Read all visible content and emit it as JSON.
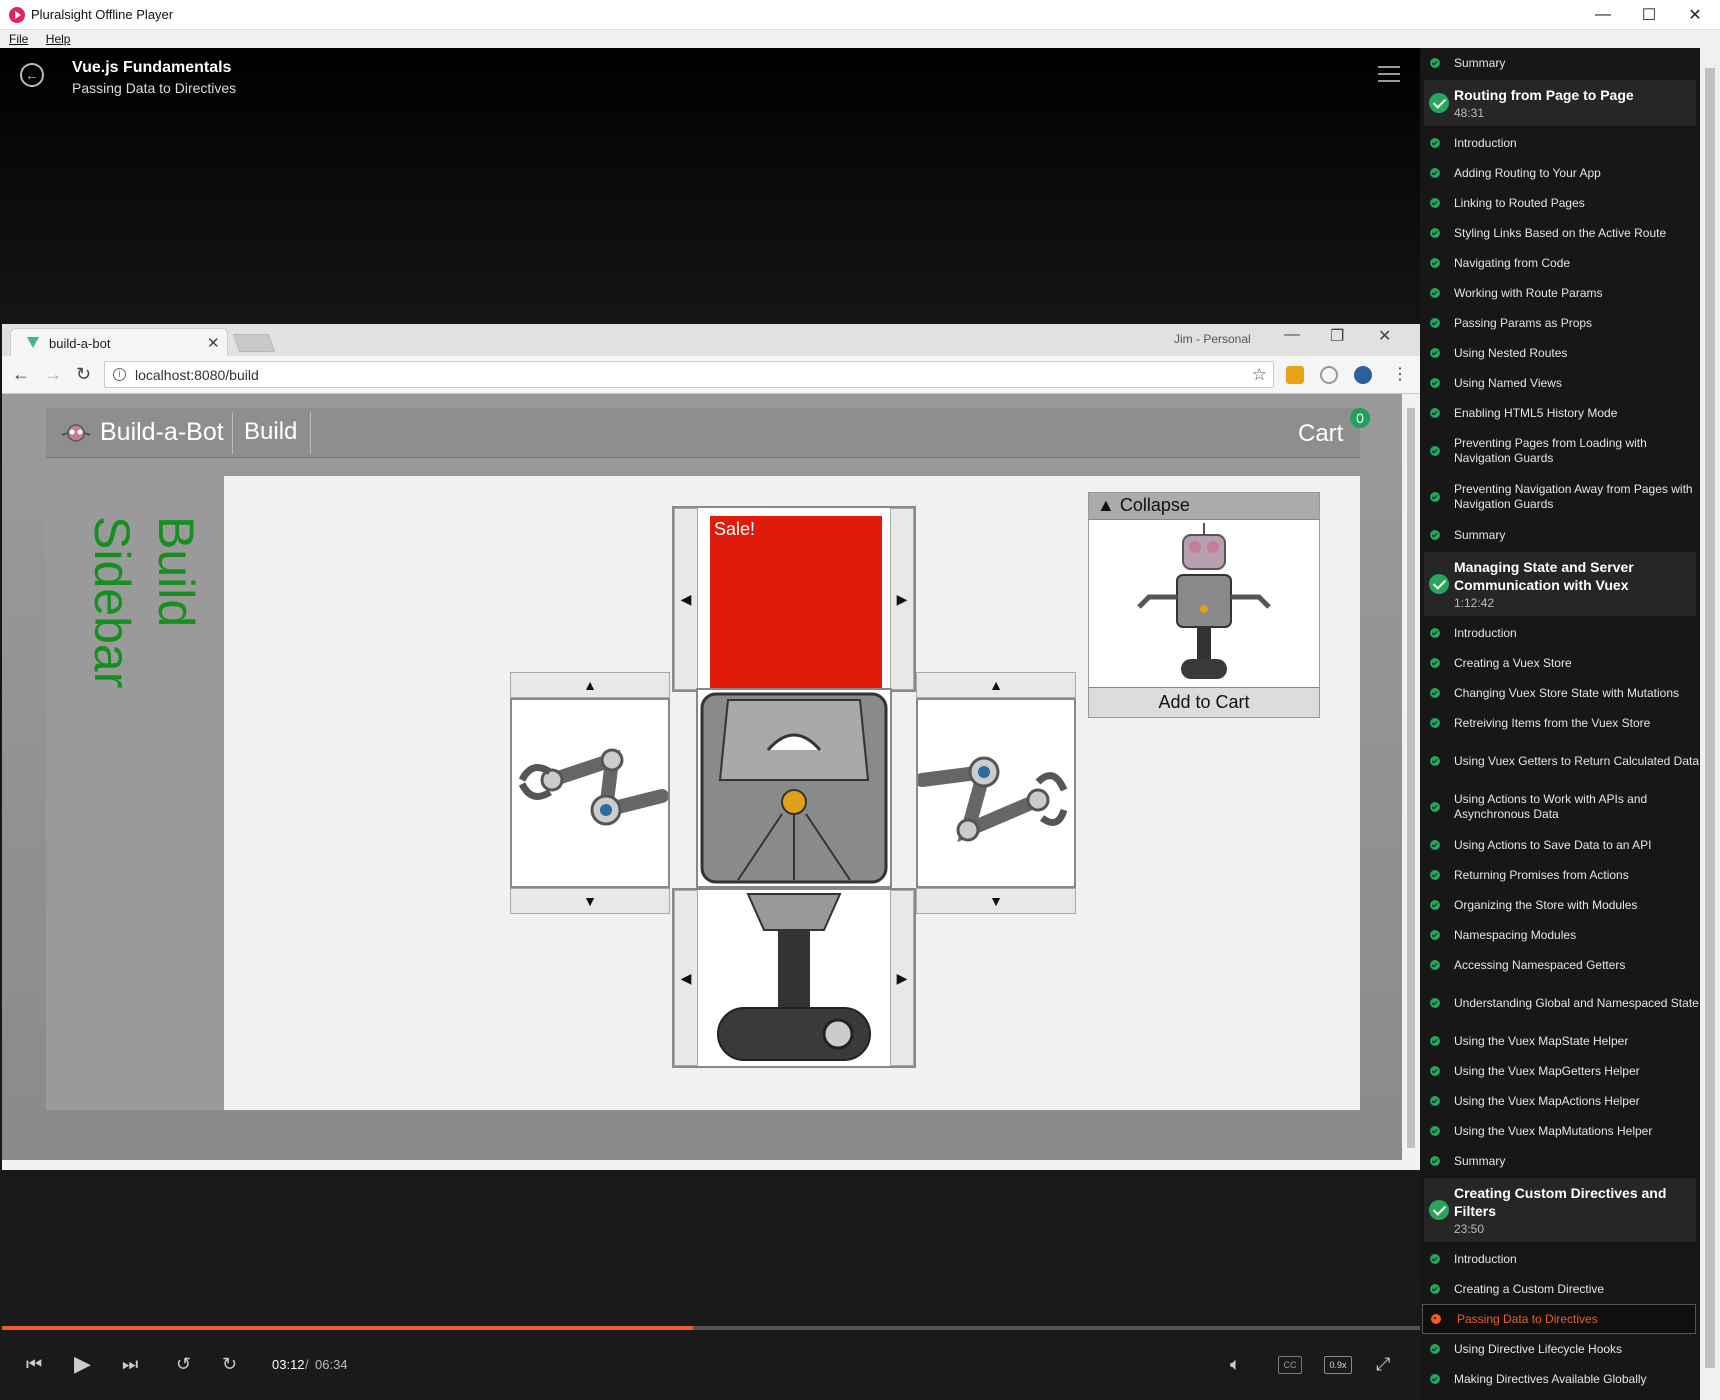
{
  "window": {
    "title": "Pluralsight Offline Player",
    "minimize": "—",
    "maximize": "☐",
    "close": "✕"
  },
  "menu": {
    "file": "File",
    "help": "Help"
  },
  "header": {
    "course_title": "Vue.js Fundamentals",
    "clip_title": "Passing Data to Directives"
  },
  "browser": {
    "tab_title": "build-a-bot",
    "profile": "Jim - Personal",
    "url": "localhost:8080/build"
  },
  "app": {
    "brand": "Build-a-Bot",
    "nav_build": "Build",
    "cart_label": "Cart",
    "cart_count": "0",
    "sidebar_text": "Build\nSidebar",
    "sale_label": "Sale!",
    "collapse_label": "▲ Collapse",
    "add_to_cart": "Add to Cart",
    "arrow_left": "◀",
    "arrow_right": "▶",
    "arrow_up": "▲",
    "arrow_down": "▼"
  },
  "player": {
    "current_time": "03:12",
    "separator": "/",
    "total_time": "06:34",
    "progress_fraction": 0.487,
    "speed": "0.9x",
    "cc": "CC"
  },
  "toc": {
    "items": [
      {
        "kind": "clip",
        "label": "Summary"
      },
      {
        "kind": "module",
        "label": "Routing from Page to Page",
        "duration": "48:31"
      },
      {
        "kind": "clip",
        "label": "Introduction"
      },
      {
        "kind": "clip",
        "label": "Adding Routing to Your App"
      },
      {
        "kind": "clip",
        "label": "Linking to Routed Pages"
      },
      {
        "kind": "clip",
        "label": "Styling Links Based on the Active Route"
      },
      {
        "kind": "clip",
        "label": "Navigating from Code"
      },
      {
        "kind": "clip",
        "label": "Working with Route Params"
      },
      {
        "kind": "clip",
        "label": "Passing Params as Props"
      },
      {
        "kind": "clip",
        "label": "Using Nested Routes"
      },
      {
        "kind": "clip",
        "label": "Using Named Views"
      },
      {
        "kind": "clip",
        "label": "Enabling HTML5 History Mode"
      },
      {
        "kind": "clip2",
        "label": "Preventing Pages from Loading with Navigation Guards"
      },
      {
        "kind": "clip2",
        "label": "Preventing Navigation Away from Pages with Navigation Guards"
      },
      {
        "kind": "clip",
        "label": "Summary"
      },
      {
        "kind": "module",
        "label": "Managing State and Server Communication with Vuex",
        "duration": "1:12:42"
      },
      {
        "kind": "clip",
        "label": "Introduction"
      },
      {
        "kind": "clip",
        "label": "Creating a Vuex Store"
      },
      {
        "kind": "clip",
        "label": "Changing Vuex Store State with Mutations"
      },
      {
        "kind": "clip",
        "label": "Retreiving Items from the Vuex Store"
      },
      {
        "kind": "clip2",
        "label": "Using Vuex Getters to Return Calculated Data"
      },
      {
        "kind": "clip2",
        "label": "Using Actions to Work with APIs and Asynchronous Data"
      },
      {
        "kind": "clip",
        "label": "Using Actions to Save Data to an API"
      },
      {
        "kind": "clip",
        "label": "Returning Promises from Actions"
      },
      {
        "kind": "clip",
        "label": "Organizing the Store with Modules"
      },
      {
        "kind": "clip",
        "label": "Namespacing Modules"
      },
      {
        "kind": "clip",
        "label": "Accessing Namespaced Getters"
      },
      {
        "kind": "clip2",
        "label": "Understanding Global and Namespaced State"
      },
      {
        "kind": "clip",
        "label": "Using the Vuex MapState Helper"
      },
      {
        "kind": "clip",
        "label": "Using the Vuex MapGetters Helper"
      },
      {
        "kind": "clip",
        "label": "Using the Vuex MapActions Helper"
      },
      {
        "kind": "clip",
        "label": "Using the Vuex MapMutations Helper"
      },
      {
        "kind": "clip",
        "label": "Summary"
      },
      {
        "kind": "module",
        "label": "Creating Custom Directives and Filters",
        "duration": "23:50"
      },
      {
        "kind": "clip",
        "label": "Introduction"
      },
      {
        "kind": "clip",
        "label": "Creating a Custom Directive"
      },
      {
        "kind": "active",
        "label": "Passing Data to Directives"
      },
      {
        "kind": "clip",
        "label": "Using Directive Lifecycle Hooks"
      },
      {
        "kind": "clip",
        "label": "Making Directives Available Globally"
      }
    ]
  },
  "colors": {
    "accent": "#f15b2a",
    "complete": "#26a65b",
    "sale": "#e01b0c",
    "sidebar_text": "#15901f",
    "vue": "#41b883"
  }
}
